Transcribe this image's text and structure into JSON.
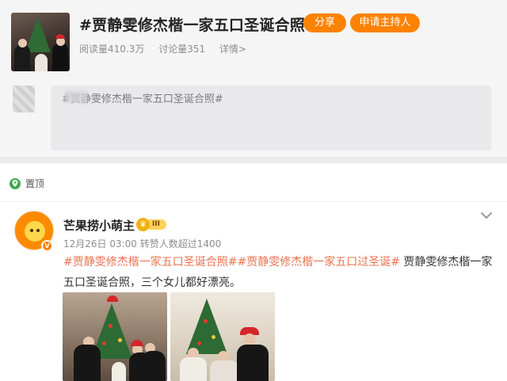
{
  "topic": {
    "title": "#贾静雯修杰楷一家五口圣诞合照#",
    "share_label": "分享",
    "host_label": "申请主持人",
    "stats": {
      "reads": "阅读量410.3万",
      "discussions": "讨论量351",
      "details": "详情>"
    }
  },
  "composer": {
    "text": "#贾静雯修杰楷一家五口圣诞合照#"
  },
  "post": {
    "pinned_label": "置顶",
    "author": "芒果捞小萌主",
    "level_badge": "III",
    "meta": "12月26日 03:00 转赞人数超过1400",
    "tag1": "#贾静雯修杰楷一家五口圣诞合照#",
    "tag2": "#贾静雯修杰楷一家五口过圣诞#",
    "text_rest": " 贾静雯修杰楷一家五口圣诞合照，三个女儿都好漂亮。"
  },
  "colors": {
    "accent": "#ff8200",
    "hashtag": "#eb7350",
    "pin": "#3fa94f"
  },
  "icons": {
    "pin": "pin-icon",
    "more": "chevron-down-icon",
    "verified": "verified-badge-icon"
  }
}
